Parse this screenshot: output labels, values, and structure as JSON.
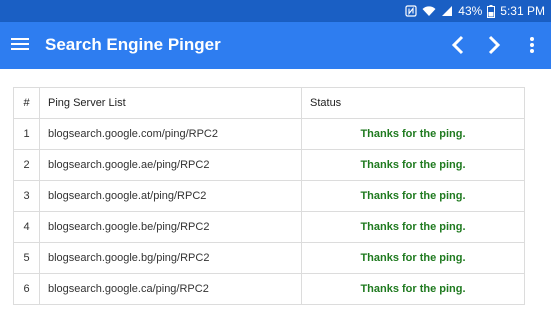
{
  "status_bar": {
    "battery": "43%",
    "time": "5:31 PM",
    "icons": [
      "nfc-icon",
      "wifi-icon",
      "signal-icon",
      "battery-icon"
    ]
  },
  "app_bar": {
    "title": "Search Engine Pinger",
    "icons": [
      "menu-icon",
      "chevron-left-icon",
      "chevron-right-icon",
      "more-vert-icon"
    ]
  },
  "table": {
    "headers": {
      "num": "#",
      "server": "Ping Server List",
      "status": "Status"
    },
    "rows": [
      {
        "num": "1",
        "server": "blogsearch.google.com/ping/RPC2",
        "status": "Thanks for the ping."
      },
      {
        "num": "2",
        "server": "blogsearch.google.ae/ping/RPC2",
        "status": "Thanks for the ping."
      },
      {
        "num": "3",
        "server": "blogsearch.google.at/ping/RPC2",
        "status": "Thanks for the ping."
      },
      {
        "num": "4",
        "server": "blogsearch.google.be/ping/RPC2",
        "status": "Thanks for the ping."
      },
      {
        "num": "5",
        "server": "blogsearch.google.bg/ping/RPC2",
        "status": "Thanks for the ping."
      },
      {
        "num": "6",
        "server": "blogsearch.google.ca/ping/RPC2",
        "status": "Thanks for the ping."
      }
    ]
  },
  "colors": {
    "status_bar": "#1a5fc4",
    "app_bar": "#2e7df0",
    "success_text": "#1f7a1f",
    "grid_line": "#dcdcdc"
  }
}
